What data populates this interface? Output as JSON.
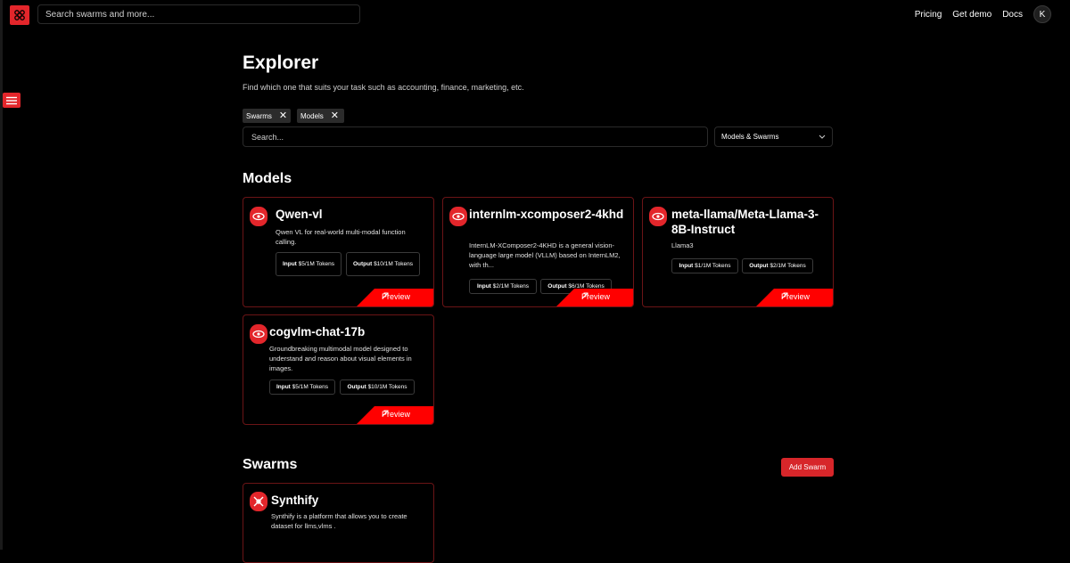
{
  "top": {
    "search_placeholder": "Search swarms and more...",
    "links": [
      "Pricing",
      "Get demo",
      "Docs"
    ],
    "avatar": "K"
  },
  "header": {
    "title": "Explorer",
    "subtitle": "Find which one that suits your task such as accounting, finance, marketing, etc."
  },
  "filters": {
    "chips": [
      "Swarms",
      "Models"
    ],
    "search_placeholder": "Search...",
    "select": "Models & Swarms"
  },
  "models": {
    "title": "Models",
    "cards": [
      {
        "name": "Qwen-vl",
        "desc": "Qwen VL for real-world multi-modal function calling.",
        "input": "$5/1M Tokens",
        "output": "$10/1M Tokens",
        "preview": "Preview"
      },
      {
        "name": "internlm-xcomposer2-4khd",
        "desc": "InternLM-XComposer2-4KHD is a general vision-language large model (VLLM) based on InternLM2, with th...",
        "input": "$2/1M Tokens",
        "output": "$6/1M Tokens",
        "preview": "Preview"
      },
      {
        "name": "meta-llama/Meta-Llama-3-8B-Instruct",
        "desc": "Llama3",
        "input": "$1/1M Tokens",
        "output": "$2/1M Tokens",
        "preview": "Preview"
      },
      {
        "name": "cogvlm-chat-17b",
        "desc": "Groundbreaking multimodal model designed to understand and reason about visual elements in images.",
        "input": "$5/1M Tokens",
        "output": "$10/1M Tokens",
        "preview": "Preview"
      }
    ]
  },
  "swarms": {
    "title": "Swarms",
    "add_label": "Add Swarm",
    "cards": [
      {
        "name": "Synthify",
        "desc": "Synthify is a platform that allows you to create dataset for llms,vlms ."
      }
    ]
  },
  "labels": {
    "input": "Input",
    "output": "Output"
  },
  "colors": {
    "accent": "#e3262b",
    "card_border": "#6b1416",
    "preview": "#ff0000"
  }
}
